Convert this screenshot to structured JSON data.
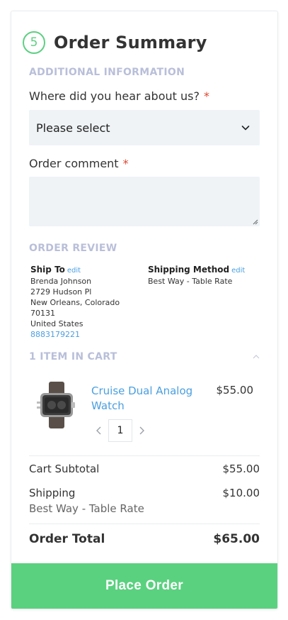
{
  "step": {
    "number": "5",
    "title": "Order Summary"
  },
  "additional_info": {
    "section_label": "ADDITIONAL INFORMATION",
    "hear_about_label": "Where did you hear about us?",
    "required_mark": "*",
    "select_value": "Please select",
    "comment_label": "Order comment",
    "comment_value": ""
  },
  "order_review": {
    "section_label": "ORDER REVIEW",
    "ship_to": {
      "title": "Ship To",
      "edit": "edit",
      "lines": [
        "Brenda Johnson",
        "2729 Hudson Pl",
        "New Orleans, Colorado 70131",
        "United States"
      ],
      "phone": "8883179221"
    },
    "shipping_method": {
      "title": "Shipping Method",
      "edit": "edit",
      "value": "Best Way - Table Rate"
    }
  },
  "cart": {
    "section_label": "1 ITEM IN CART",
    "items": [
      {
        "name": "Cruise Dual Analog Watch",
        "price": "$55.00",
        "qty": "1"
      }
    ]
  },
  "totals": {
    "subtotal_label": "Cart Subtotal",
    "subtotal_value": "$55.00",
    "shipping_label": "Shipping",
    "shipping_value": "$10.00",
    "shipping_method": "Best Way - Table Rate",
    "total_label": "Order Total",
    "total_value": "$65.00"
  },
  "place_order_label": "Place Order",
  "colors": {
    "accent": "#5ad17f",
    "link": "#4a9fe0",
    "section": "#b9bfd9",
    "required": "#e0452f"
  }
}
